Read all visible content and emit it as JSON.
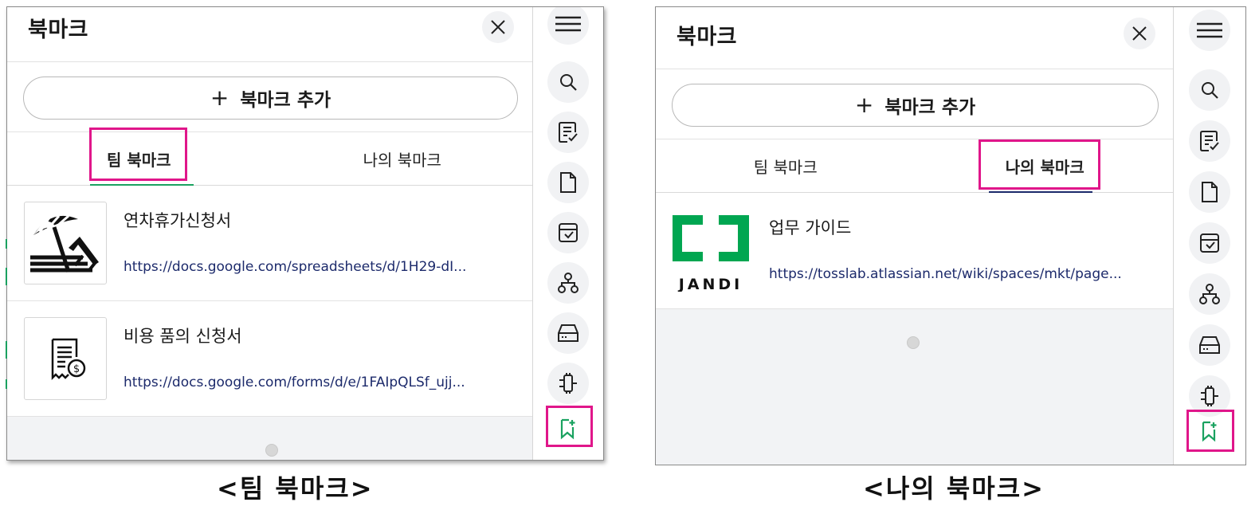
{
  "left_panel": {
    "title": "북마크",
    "add_button_label": "북마크 추가",
    "tabs": [
      {
        "label": "팀 북마크",
        "active": true
      },
      {
        "label": "나의 북마크",
        "active": false
      }
    ],
    "items": [
      {
        "title": "연차휴가신청서",
        "url": "https://docs.google.com/spreadsheets/d/1H29-dI...",
        "icon": "beach-umbrella-icon"
      },
      {
        "title": "비용 품의 신청서",
        "url": "https://docs.google.com/forms/d/e/1FAIpQLSf_ujj...",
        "icon": "receipt-dollar-icon"
      }
    ]
  },
  "right_panel": {
    "title": "북마크",
    "add_button_label": "북마크 추가",
    "tabs": [
      {
        "label": "팀 북마크",
        "active": false
      },
      {
        "label": "나의 북마크",
        "active": true
      }
    ],
    "items": [
      {
        "title": "업무 가이드",
        "url": "https://tosslab.atlassian.net/wiki/spaces/mkt/page...",
        "icon": "jandi-logo",
        "logo_text": "JANDI"
      }
    ]
  },
  "rail_icons": [
    "menu-icon",
    "search-icon",
    "checklist-icon",
    "file-icon",
    "archive-icon",
    "org-chart-icon",
    "drive-icon",
    "connect-plug-icon",
    "bookmark-icon"
  ],
  "captions": {
    "left": "<팀 북마크>",
    "right": "<나의 북마크>"
  },
  "colors": {
    "highlight": "#e0168a",
    "accent_green": "#1aa260",
    "jandi_green": "#00a651",
    "link": "#1c2a6b",
    "active_underline_right": "#1c2a6b"
  }
}
